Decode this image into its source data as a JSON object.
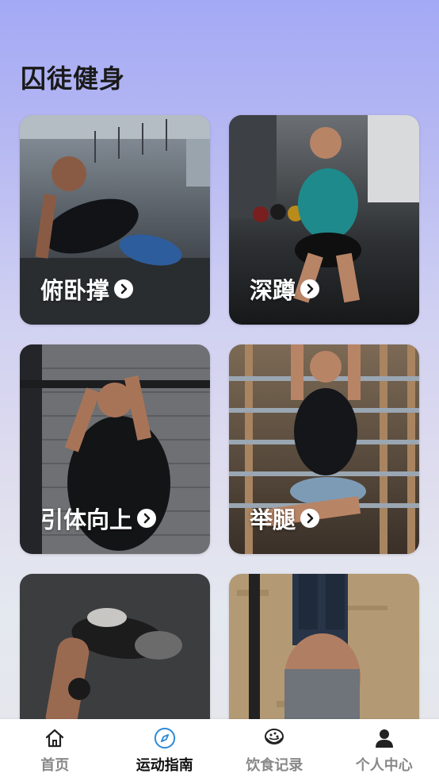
{
  "page": {
    "title": "囚徒健身"
  },
  "exercises": [
    {
      "label": "俯卧撑",
      "icon": "chevron-right-circle-icon"
    },
    {
      "label": "深蹲",
      "icon": "chevron-right-circle-icon"
    },
    {
      "label": "引体向上",
      "icon": "chevron-right-circle-icon"
    },
    {
      "label": "举腿",
      "icon": "chevron-right-circle-icon"
    },
    {
      "label": "",
      "icon": ""
    },
    {
      "label": "",
      "icon": ""
    }
  ],
  "tabbar": {
    "active_index": 1,
    "active_color": "#2f8cd8",
    "items": [
      {
        "label": "首页",
        "icon": "home-icon"
      },
      {
        "label": "运动指南",
        "icon": "compass-icon"
      },
      {
        "label": "饮食记录",
        "icon": "food-bowl-icon"
      },
      {
        "label": "个人中心",
        "icon": "user-icon"
      }
    ]
  }
}
